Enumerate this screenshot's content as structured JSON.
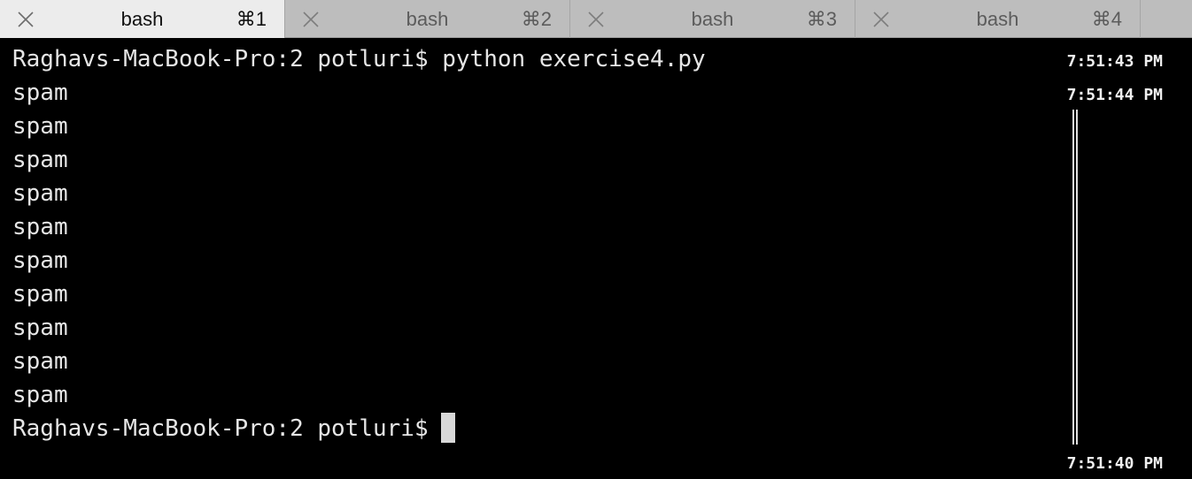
{
  "tabs": [
    {
      "title": "bash",
      "shortcut": "⌘1",
      "active": true
    },
    {
      "title": "bash",
      "shortcut": "⌘2",
      "active": false
    },
    {
      "title": "bash",
      "shortcut": "⌘3",
      "active": false
    },
    {
      "title": "bash",
      "shortcut": "⌘4",
      "active": false
    }
  ],
  "terminal": {
    "lines": [
      "Raghavs-MacBook-Pro:2 potluri$ python exercise4.py",
      "spam",
      "spam",
      "spam",
      "spam",
      "spam",
      "spam",
      "spam",
      "spam",
      "spam",
      "spam"
    ],
    "prompt": "Raghavs-MacBook-Pro:2 potluri$",
    "timestamps": {
      "command": "7:51:43 PM",
      "output_start": "7:51:44 PM",
      "current": "7:51:40 PM"
    }
  },
  "colors": {
    "background": "#000000",
    "text": "#e6e6e6",
    "tabbar": "#bdbdbd",
    "active_tab": "#ececec"
  }
}
